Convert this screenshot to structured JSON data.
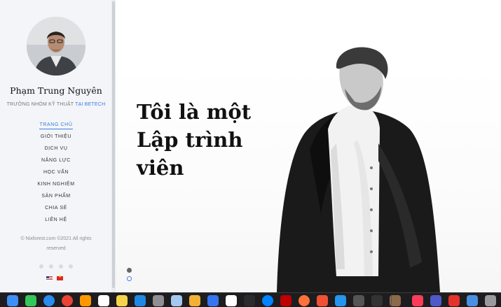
{
  "sidebar": {
    "name": "Phạm Trung Nguyên",
    "subtitle_prefix": "TRƯỞNG NHÓM KỸ THUẬT",
    "subtitle_company": "TẠI BETECH",
    "menu": [
      {
        "label": "TRANG CHỦ",
        "active": true
      },
      {
        "label": "GIỚI THIỆU",
        "active": false
      },
      {
        "label": "DỊCH VỤ",
        "active": false
      },
      {
        "label": "NĂNG LỰC",
        "active": false
      },
      {
        "label": "HỌC VẤN",
        "active": false
      },
      {
        "label": "KINH NGHIỆM",
        "active": false
      },
      {
        "label": "SẢN PHẨM",
        "active": false
      },
      {
        "label": "CHIA SẺ",
        "active": false
      },
      {
        "label": "LIÊN HỆ",
        "active": false
      }
    ],
    "copyright": "© Nixforest.com ©2021 All rights reserved",
    "languages": [
      "english-flag",
      "vietnam-flag"
    ],
    "accent_color": "#3b7de0"
  },
  "hero": {
    "lines": [
      "Tôi là một",
      "Lập trình",
      "viên"
    ],
    "slides": 2,
    "active_slide": 1
  },
  "dock": {
    "icons": [
      {
        "name": "finder-icon",
        "color": "#3d8ff5"
      },
      {
        "name": "messages-icon",
        "color": "#34c759"
      },
      {
        "name": "safari-icon",
        "color": "#2a8cf0"
      },
      {
        "name": "chrome-icon",
        "color": "#ea4335"
      },
      {
        "name": "sublime-icon",
        "color": "#ff9800"
      },
      {
        "name": "calendar-icon",
        "color": "#ffffff"
      },
      {
        "name": "notes-icon",
        "color": "#f6d34a"
      },
      {
        "name": "vscode-icon",
        "color": "#1e88e5"
      },
      {
        "name": "preferences-icon",
        "color": "#8e8e93"
      },
      {
        "name": "preview-icon",
        "color": "#a4c8f0"
      },
      {
        "name": "photos-icon",
        "color": "#f2b134"
      },
      {
        "name": "xcode-icon",
        "color": "#3575f0"
      },
      {
        "name": "notion-icon",
        "color": "#ffffff"
      },
      {
        "name": "terminal-icon",
        "color": "#2b2b2b"
      },
      {
        "name": "messenger-icon",
        "color": "#0084ff"
      },
      {
        "name": "filezilla-icon",
        "color": "#bf0000"
      },
      {
        "name": "firefox-icon",
        "color": "#ff7139"
      },
      {
        "name": "git-icon",
        "color": "#f05033"
      },
      {
        "name": "docker-icon",
        "color": "#2496ed"
      },
      {
        "name": "tools-icon",
        "color": "#555555"
      },
      {
        "name": "iterm-icon",
        "color": "#333333"
      },
      {
        "name": "gimp-icon",
        "color": "#8a6a4a"
      },
      {
        "name": "music-icon",
        "color": "#fa3c5a"
      },
      {
        "name": "teams-icon",
        "color": "#5059c9"
      },
      {
        "name": "anydesk-icon",
        "color": "#e4322b"
      },
      {
        "name": "mail-icon",
        "color": "#4a90e2"
      },
      {
        "name": "trash-icon",
        "color": "#9a9a9e"
      }
    ]
  }
}
